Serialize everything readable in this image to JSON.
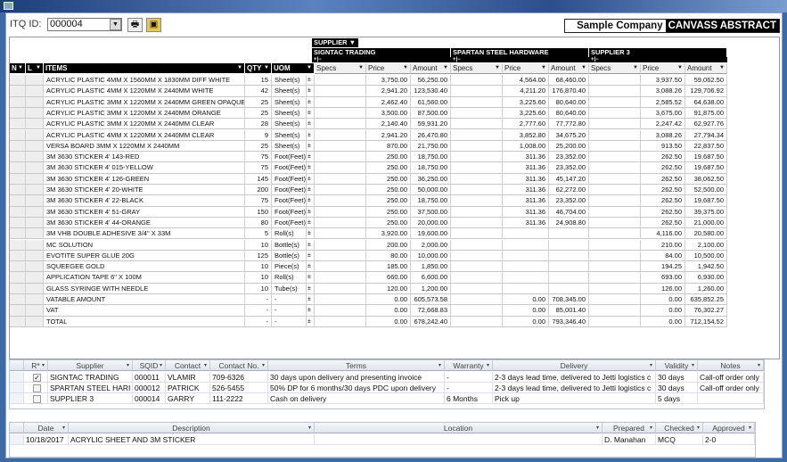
{
  "toolbar": {
    "itq_label": "ITQ ID:",
    "itq_value": "000004",
    "print_icon": "printer-icon",
    "save_icon": "save-icon"
  },
  "header": {
    "company": "Sample Company",
    "title": "CANVASS ABSTRACT"
  },
  "grid": {
    "supplier_label": "SUPPLIER",
    "suppliers": [
      "SIGNTAC TRADING",
      "SPARTAN STEEL HARDWARE",
      "SUPPLIER 3"
    ],
    "columns": {
      "n": "N",
      "l": "L",
      "items": "ITEMS",
      "qty": "QTY",
      "uom": "UOM",
      "specs": "Specs",
      "price": "Price",
      "amount": "Amount"
    },
    "rows": [
      [
        "ACRYLIC PLASTIC 4MM X 1560MM X 1830MM DIFF WHITE",
        "15",
        "Sheet(s)",
        "3,750.00",
        "56,250.00",
        "4,564.00",
        "68,460.00",
        "3,937.50",
        "59,062.50"
      ],
      [
        "ACRYLIC PLASTIC 4MM X 1220MM X 2440MM WHITE",
        "42",
        "Sheet(s)",
        "2,941.20",
        "123,530.40",
        "4,211.20",
        "176,870.40",
        "3,088.26",
        "129,706.92"
      ],
      [
        "ACRYLIC PLASTIC 3MM X 1220MM X 2440MM GREEN OPAQUE",
        "25",
        "Sheet(s)",
        "2,462.40",
        "61,560.00",
        "3,225.60",
        "80,640.00",
        "2,585.52",
        "64,638.00"
      ],
      [
        "ACRYLIC PLASTIC 3MM X 1220MM X 2440MM ORANGE",
        "25",
        "Sheet(s)",
        "3,500.00",
        "87,500.00",
        "3,225.60",
        "80,640.00",
        "3,675.00",
        "91,875.00"
      ],
      [
        "ACRYLIC PLASTIC 3MM X 1220MM X 2440MM CLEAR",
        "28",
        "Sheet(s)",
        "2,140.40",
        "59,931.20",
        "2,777.60",
        "77,772.80",
        "2,247.42",
        "62,927.76"
      ],
      [
        "ACRYLIC PLASTIC 4MM X 1220MM X 2440MM CLEAR",
        "9",
        "Sheet(s)",
        "2,941.20",
        "26,470.80",
        "3,852.80",
        "34,675.20",
        "3,088.26",
        "27,794.34"
      ],
      [
        "VERSA BOARD 3MM X 1220MM X 2440MM",
        "25",
        "Sheet(s)",
        "870.00",
        "21,750.00",
        "1,008.00",
        "25,200.00",
        "913.50",
        "22,837.50"
      ],
      [
        "3M 3630 STICKER 4' 143-RED",
        "75",
        "Foot(Feet)",
        "250.00",
        "18,750.00",
        "311.36",
        "23,352.00",
        "262.50",
        "19,687.50"
      ],
      [
        "3M 3630 STICKER 4' 015-YELLOW",
        "75",
        "Foot(Feet)",
        "250.00",
        "18,750.00",
        "311.36",
        "23,352.00",
        "262.50",
        "19,687.50"
      ],
      [
        "3M 3630 STICKER 4' 126-GREEN",
        "145",
        "Foot(Feet)",
        "250.00",
        "36,250.00",
        "311.36",
        "45,147.20",
        "262.50",
        "38,062.50"
      ],
      [
        "3M 3630 STICKER 4' 20-WHITE",
        "200",
        "Foot(Feet)",
        "250.00",
        "50,000.00",
        "311.36",
        "62,272.00",
        "262.50",
        "52,500.00"
      ],
      [
        "3M 3630 STICKER 4' 22-BLACK",
        "75",
        "Foot(Feet)",
        "250.00",
        "18,750.00",
        "311.36",
        "23,352.00",
        "262.50",
        "19,687.50"
      ],
      [
        "3M 3630 STICKER 4' 51-GRAY",
        "150",
        "Foot(Feet)",
        "250.00",
        "37,500.00",
        "311.36",
        "46,704.00",
        "262.50",
        "39,375.00"
      ],
      [
        "3M 3630 STICKER 4' 44-ORANGE",
        "80",
        "Foot(Feet)",
        "250.00",
        "20,000.00",
        "311.36",
        "24,908.80",
        "262.50",
        "21,000.00"
      ],
      [
        "3M VHB DOUBLE ADHESIVE 3/4\" X 33M",
        "5",
        "Roll(s)",
        "3,920.00",
        "19,600.00",
        "",
        "",
        "4,116.00",
        "20,580.00"
      ],
      [
        "MC SOLUTION",
        "10",
        "Bottle(s)",
        "200.00",
        "2,000.00",
        "",
        "",
        "210.00",
        "2,100.00"
      ],
      [
        "EVOTITE SUPER GLUE 20G",
        "125",
        "Bottle(s)",
        "80.00",
        "10,000.00",
        "",
        "",
        "84.00",
        "10,500.00"
      ],
      [
        "SQUEEGEE GOLD",
        "10",
        "Piece(s)",
        "185.00",
        "1,850.00",
        "",
        "",
        "194.25",
        "1,942.50"
      ],
      [
        "APPLICATION TAPE 6\" X 100M",
        "10",
        "Roll(s)",
        "660.00",
        "6,600.00",
        "",
        "",
        "693.00",
        "6,930.00"
      ],
      [
        "GLASS SYRINGE WITH NEEDLE",
        "10",
        "Tube(s)",
        "120.00",
        "1,200.00",
        "",
        "",
        "126.00",
        "1,260.00"
      ],
      [
        "VATABLE AMOUNT",
        "-",
        "-",
        "0.00",
        "605,573.58",
        "0.00",
        "708,345.00",
        "0.00",
        "635,852.25"
      ],
      [
        "VAT",
        "-",
        "-",
        "0.00",
        "72,668.83",
        "0.00",
        "85,001.40",
        "0.00",
        "76,302.27"
      ],
      [
        "TOTAL",
        "-",
        "-",
        "0.00",
        "678,242.40",
        "0.00",
        "793,346.40",
        "0.00",
        "712,154.52"
      ]
    ]
  },
  "suppliers_grid": {
    "columns": [
      "R*",
      "Supplier",
      "SQID",
      "Contact",
      "Contact No.",
      "Terms",
      "Warranty",
      "Delivery",
      "Validity",
      "Notes"
    ],
    "rows": [
      {
        "checked": true,
        "cells": [
          "SIGNTAC TRADING",
          "000011",
          "VLAMIR",
          "709-6326",
          "30 days upon delivery and presenting invoice",
          "-",
          "2-3 days lead time, delivered to Jetti logistics c",
          "30 days",
          "Call-off order only"
        ]
      },
      {
        "checked": false,
        "cells": [
          "SPARTAN STEEL HARI",
          "000012",
          "PATRICK",
          "526-5455",
          "50% DP for 6 months/30 days PDC upon delivery",
          "-",
          "2-3 days lead time, delivered to Jetti logistics c",
          "30 days",
          "Call-off order only"
        ]
      },
      {
        "checked": false,
        "cells": [
          "SUPPLIER 3",
          "000014",
          "GARRY",
          "111-2222",
          "Cash on delivery",
          "6 Months",
          "Pick up",
          "5 days",
          ""
        ]
      }
    ]
  },
  "info_grid": {
    "columns": [
      "Date",
      "Description",
      "Location",
      "Prepared",
      "Checked",
      "Approved"
    ],
    "rows": [
      [
        "10/18/2017",
        "ACRYLIC SHEET AND 3M STICKER",
        "",
        "D. Manahan",
        "MCQ",
        "2-0"
      ]
    ]
  }
}
